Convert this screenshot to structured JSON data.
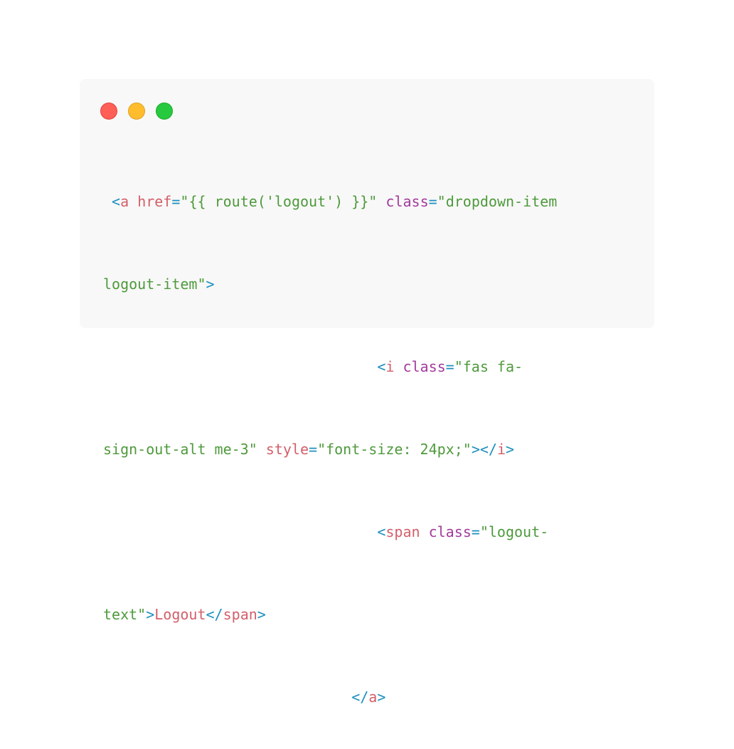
{
  "window": {
    "buttons": [
      {
        "name": "close",
        "color": "#ff5f56"
      },
      {
        "name": "minimize",
        "color": "#ffbd2e"
      },
      {
        "name": "maximize",
        "color": "#27c93f"
      }
    ]
  },
  "code": {
    "l1": {
      "indent": " ",
      "lt": "<",
      "tag": "a",
      "sp1": " ",
      "attr1": "href",
      "eq1": "=",
      "val1": "\"{{ route('logout') }}\"",
      "sp2": " ",
      "attr2": "class",
      "eq2": "=",
      "val2": "\"dropdown-item"
    },
    "l2": {
      "val": "logout-item\"",
      "gt": ">"
    },
    "l3": {
      "indent": "                                ",
      "lt": "<",
      "tag": "i",
      "sp": " ",
      "attr": "class",
      "eq": "=",
      "val": "\"fas fa-"
    },
    "l4": {
      "val1": "sign-out-alt me-3\"",
      "sp": " ",
      "attr": "style",
      "eq": "=",
      "val2": "\"font-size: 24px;\"",
      "gt": ">",
      "close_lt": "</",
      "close_tag": "i",
      "close_gt": ">"
    },
    "l5": {
      "indent": "                                ",
      "lt": "<",
      "tag": "span",
      "sp": " ",
      "attr": "class",
      "eq": "=",
      "val": "\"logout-"
    },
    "l6": {
      "val": "text\"",
      "gt": ">",
      "content": "Logout",
      "close_lt": "</",
      "close_tag": "span",
      "close_gt": ">"
    },
    "l7": {
      "indent": "                             ",
      "close_lt": "</",
      "close_tag": "a",
      "close_gt": ">"
    }
  }
}
